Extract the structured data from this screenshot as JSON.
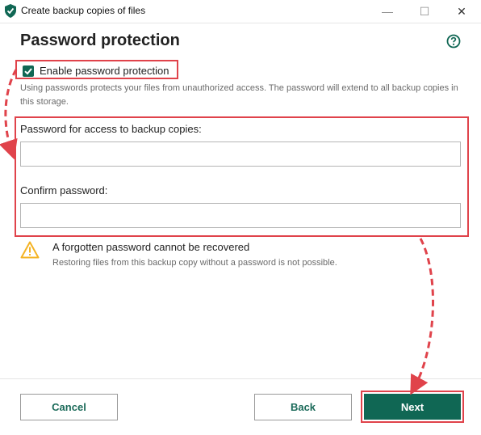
{
  "window": {
    "title": "Create backup copies of files",
    "minimize_glyph": "—",
    "maximize_glyph": "☐",
    "close_glyph": "✕"
  },
  "page": {
    "heading": "Password protection",
    "help_icon": "question-circle-icon"
  },
  "enable_password": {
    "label": "Enable password protection",
    "checked": true
  },
  "description": "Using passwords protects your files from unauthorized access. The password will extend to all backup copies in this storage.",
  "password_field": {
    "label": "Password for access to backup copies:",
    "value": ""
  },
  "confirm_field": {
    "label": "Confirm password:",
    "value": ""
  },
  "warning": {
    "icon": "warning-triangle-icon",
    "title": "A forgotten password cannot be recovered",
    "text": "Restoring files from this backup copy without a password is not possible."
  },
  "buttons": {
    "cancel": "Cancel",
    "back": "Back",
    "next": "Next"
  },
  "colors": {
    "accent": "#106754",
    "highlight": "#e0434b",
    "warning": "#f4b324"
  }
}
